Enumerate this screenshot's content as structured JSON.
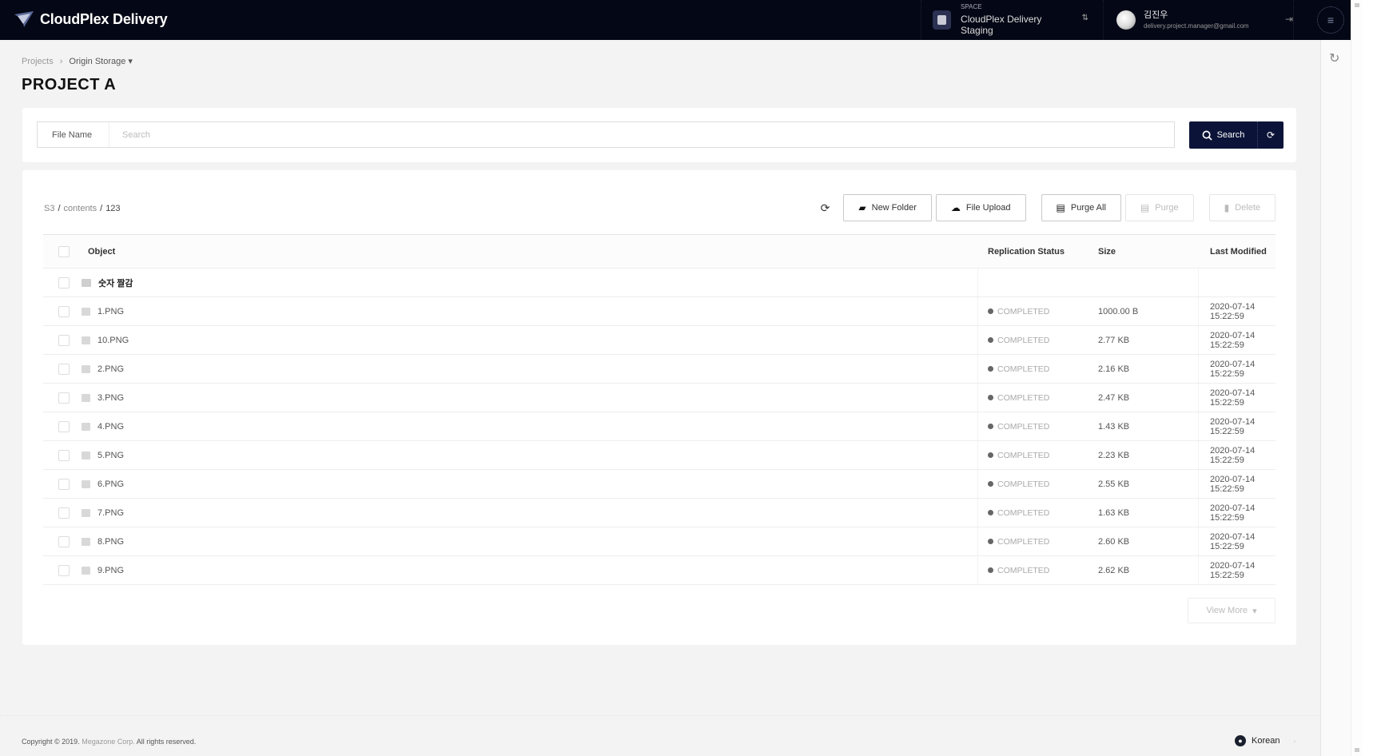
{
  "header": {
    "app_name": "CloudPlex Delivery",
    "space": {
      "label": "SPACE",
      "name": "CloudPlex Delivery Staging",
      "switch_icon": "switch-arrows-icon"
    },
    "user": {
      "name": "김진우",
      "email": "delivery.project.manager@gmail.com"
    },
    "icons": {
      "logout": "logout-icon",
      "menu": "menu-icon"
    }
  },
  "breadcrumb": {
    "items": [
      "Projects",
      "Origin Storage"
    ],
    "separator": "›",
    "dropdown_glyph": "▾"
  },
  "page_title": "PROJECT A",
  "search": {
    "field_label": "File Name",
    "placeholder": "Search",
    "value": "",
    "search_label": "Search",
    "reset_icon": "reset-icon"
  },
  "list": {
    "path": [
      "S3",
      "contents",
      "123"
    ],
    "toolbar": {
      "refresh_icon": "refresh-icon",
      "new_folder": "New Folder",
      "file_upload": "File Upload",
      "purge_all": "Purge All",
      "purge": "Purge",
      "delete": "Delete"
    },
    "columns": [
      "Object",
      "Replication Status",
      "Size",
      "Last Modified"
    ],
    "folder": {
      "name": "숫자 짤감"
    },
    "rows": [
      {
        "name": "1.PNG",
        "status": "COMPLETED",
        "size": "1000.00 B",
        "modified": "2020-07-14 15:22:59"
      },
      {
        "name": "10.PNG",
        "status": "COMPLETED",
        "size": "2.77 KB",
        "modified": "2020-07-14 15:22:59"
      },
      {
        "name": "2.PNG",
        "status": "COMPLETED",
        "size": "2.16 KB",
        "modified": "2020-07-14 15:22:59"
      },
      {
        "name": "3.PNG",
        "status": "COMPLETED",
        "size": "2.47 KB",
        "modified": "2020-07-14 15:22:59"
      },
      {
        "name": "4.PNG",
        "status": "COMPLETED",
        "size": "1.43 KB",
        "modified": "2020-07-14 15:22:59"
      },
      {
        "name": "5.PNG",
        "status": "COMPLETED",
        "size": "2.23 KB",
        "modified": "2020-07-14 15:22:59"
      },
      {
        "name": "6.PNG",
        "status": "COMPLETED",
        "size": "2.55 KB",
        "modified": "2020-07-14 15:22:59"
      },
      {
        "name": "7.PNG",
        "status": "COMPLETED",
        "size": "1.63 KB",
        "modified": "2020-07-14 15:22:59"
      },
      {
        "name": "8.PNG",
        "status": "COMPLETED",
        "size": "2.60 KB",
        "modified": "2020-07-14 15:22:59"
      },
      {
        "name": "9.PNG",
        "status": "COMPLETED",
        "size": "2.62 KB",
        "modified": "2020-07-14 15:22:59"
      }
    ],
    "view_more": "View More"
  },
  "footer": {
    "copyright_prefix": "Copyright © 2019.",
    "company": "Megazone Corp.",
    "rights": "All rights reserved.",
    "language": "Korean"
  },
  "colors": {
    "header_bg": "#040715",
    "primary_button": "#0b1438",
    "page_bg": "#f3f3f3"
  }
}
